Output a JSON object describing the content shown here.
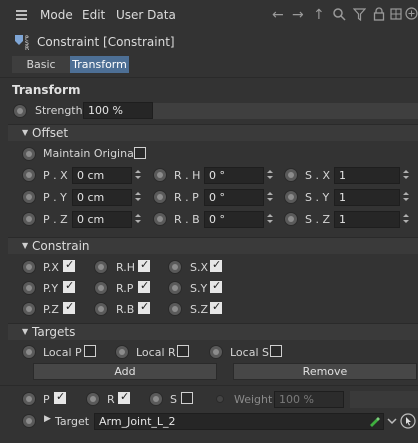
{
  "menubar": {
    "items": [
      "Mode",
      "Edit",
      "User Data"
    ],
    "icons": [
      "arrow-left-icon",
      "arrow-right-icon",
      "arrow-up-icon",
      "search-icon",
      "filter-icon",
      "lock-icon",
      "grid-icon",
      "plus-icon"
    ]
  },
  "object": {
    "title": "Constraint [Constraint]",
    "icon": "constraint-tag-icon"
  },
  "tabs": [
    {
      "label": "Basic",
      "active": false
    },
    {
      "label": "Transform",
      "active": true
    }
  ],
  "transform": {
    "title": "Transform",
    "strength_label": "Strength",
    "strength_value": "100 %",
    "strength_fraction": 1.0
  },
  "offset": {
    "title": "Offset",
    "maintain_label": "Maintain Original",
    "maintain_checked": false,
    "rows": [
      {
        "p_label": "P . X",
        "p_value": "0 cm",
        "r_label": "R . H",
        "r_value": "0 °",
        "s_label": "S . X",
        "s_value": "1"
      },
      {
        "p_label": "P . Y",
        "p_value": "0 cm",
        "r_label": "R . P",
        "r_value": "0 °",
        "s_label": "S . Y",
        "s_value": "1"
      },
      {
        "p_label": "P . Z",
        "p_value": "0 cm",
        "r_label": "R . B",
        "r_value": "0 °",
        "s_label": "S . Z",
        "s_value": "1"
      }
    ]
  },
  "constrain": {
    "title": "Constrain",
    "rows": [
      [
        "P.X",
        "R.H",
        "S.X"
      ],
      [
        "P.Y",
        "R.P",
        "S.Y"
      ],
      [
        "P.Z",
        "R.B",
        "S.Z"
      ]
    ]
  },
  "targets": {
    "title": "Targets",
    "local_p": "Local P",
    "local_r": "Local R",
    "local_s": "Local S",
    "add_label": "Add",
    "remove_label": "Remove",
    "p_label": "P",
    "r_label": "R",
    "s_label": "S",
    "weight_label": "Weight",
    "weight_value": "100 %",
    "target_label": "Target",
    "target_value": "Arm_Joint_L_2"
  },
  "colors": {
    "background": "#333333",
    "field": "#262626",
    "tab_active": "#4d6f95",
    "pick_green": "#3fae3f"
  }
}
